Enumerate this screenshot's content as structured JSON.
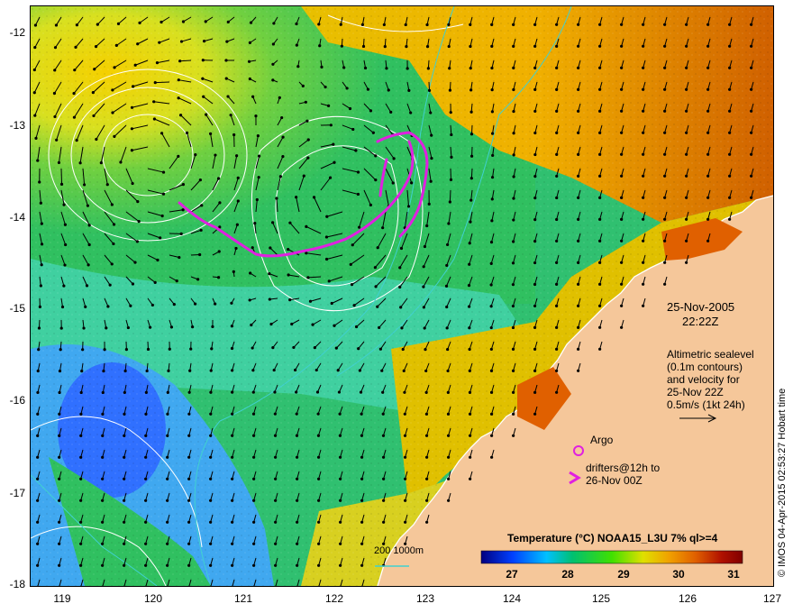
{
  "map": {
    "date": "25-Nov-2005",
    "time": "22:22Z",
    "altimetry_lines": [
      "Altimetric sealevel",
      "(0.1m contours)",
      "and velocity for",
      "25-Nov 22Z",
      "0.5m/s (1kt 24h)"
    ],
    "argo_label": "Argo",
    "drifters_lines": [
      "drifters@12h to",
      "26-Nov 00Z"
    ],
    "bathymetry_label": "200  1000m",
    "credit": "© IMOS 04-Apr-2015 02:53:27 Hobart time",
    "lat_labels": [
      "-12",
      "-13",
      "-14",
      "-15",
      "-16",
      "-17",
      "-18"
    ],
    "lon_labels": [
      "119",
      "120",
      "121",
      "122",
      "123",
      "124",
      "125",
      "126",
      "127"
    ],
    "colors": {
      "land": "#f5c79a",
      "argo": "#e020e0",
      "drifter": "#e020e0",
      "contour": "#ffffff",
      "isobath": "#40d0d0"
    }
  },
  "colorbar": {
    "title": "Temperature (°C) NOAA15_L3U 7% ql>=4",
    "ticks": [
      "27",
      "28",
      "29",
      "30",
      "31"
    ],
    "stops": [
      "#000080",
      "#0040ff",
      "#00c0ff",
      "#00c070",
      "#40e000",
      "#e0e000",
      "#f0a000",
      "#e06000",
      "#b01000",
      "#800000"
    ]
  }
}
